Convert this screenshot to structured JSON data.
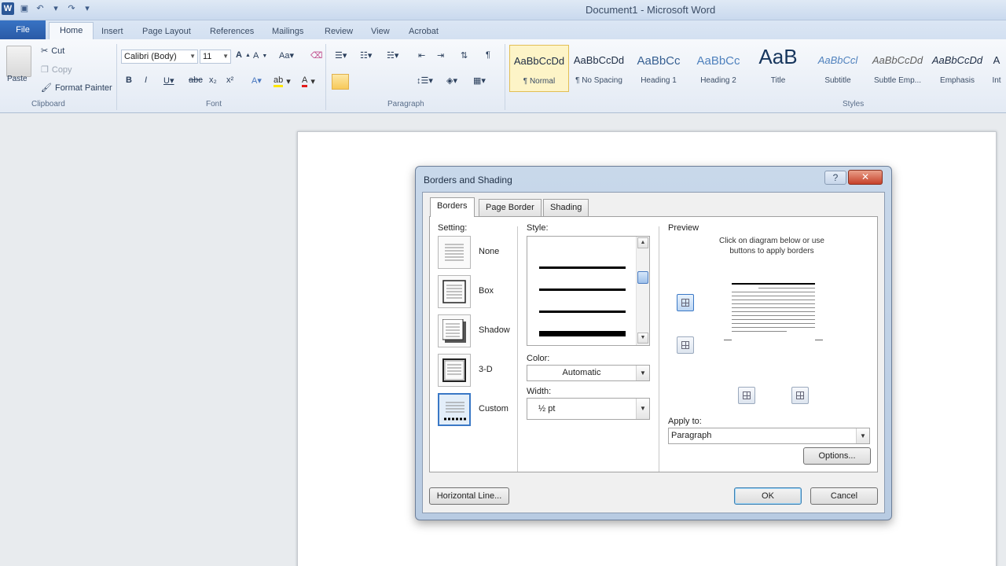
{
  "window": {
    "title": "Document1 - Microsoft Word"
  },
  "ribbon_tabs": [
    "File",
    "Home",
    "Insert",
    "Page Layout",
    "References",
    "Mailings",
    "Review",
    "View",
    "Acrobat"
  ],
  "clipboard": {
    "paste": "Paste",
    "cut": "Cut",
    "copy": "Copy",
    "format_painter": "Format Painter",
    "group_label": "Clipboard"
  },
  "font": {
    "name": "Calibri (Body)",
    "size": "11",
    "group_label": "Font"
  },
  "paragraph": {
    "group_label": "Paragraph"
  },
  "styles": {
    "group_label": "Styles",
    "items": [
      {
        "sample": "AaBbCcDd",
        "name": "¶ Normal"
      },
      {
        "sample": "AaBbCcDd",
        "name": "¶ No Spacing"
      },
      {
        "sample": "AaBbCc",
        "name": "Heading 1"
      },
      {
        "sample": "AaBbCc",
        "name": "Heading 2"
      },
      {
        "sample": "AaB",
        "name": "Title"
      },
      {
        "sample": "AaBbCcl",
        "name": "Subtitle"
      },
      {
        "sample": "AaBbCcDd",
        "name": "Subtle Emp..."
      },
      {
        "sample": "AaBbCcDd",
        "name": "Emphasis"
      },
      {
        "sample": "A",
        "name": "Int"
      }
    ]
  },
  "dialog": {
    "title": "Borders and Shading",
    "help_glyph": "?",
    "close_glyph": "✕",
    "tabs": [
      "Borders",
      "Page Border",
      "Shading"
    ],
    "setting_label": "Setting:",
    "settings": [
      "None",
      "Box",
      "Shadow",
      "3-D",
      "Custom"
    ],
    "style_label": "Style:",
    "color_label": "Color:",
    "color_value": "Automatic",
    "width_label": "Width:",
    "width_value": "½ pt",
    "preview_label": "Preview",
    "preview_help": "Click on diagram below or use buttons to apply borders",
    "apply_to_label": "Apply to:",
    "apply_to_value": "Paragraph",
    "options_button": "Options...",
    "horizontal_line_button": "Horizontal Line...",
    "ok_button": "OK",
    "cancel_button": "Cancel"
  },
  "icons": {
    "word": "W",
    "scroll_up": "▲",
    "scroll_down": "▼",
    "dropdown": "▼"
  }
}
